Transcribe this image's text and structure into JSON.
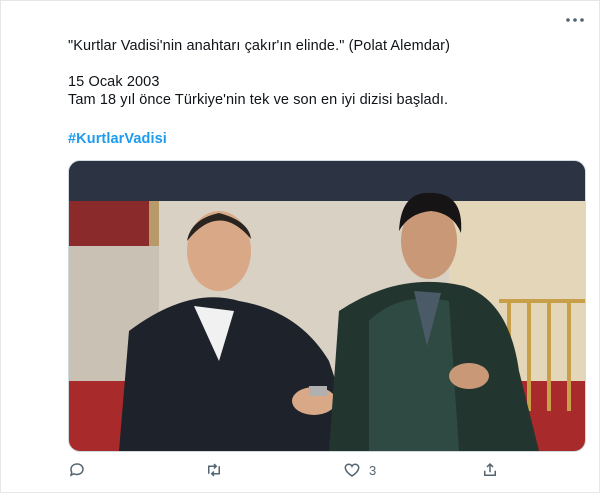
{
  "tweet": {
    "quote_line": "\"Kurtlar Vadisi'nin anahtarı çakır'ın elinde.\" (Polat Alemdar)",
    "date_line": "15 Ocak 2003",
    "body_line": "Tam 18 yıl önce Türkiye'nin tek ve son en iyi dizisi başladı.",
    "hashtag": "#KurtlarVadisi"
  },
  "media": {
    "description_icon": "photo"
  },
  "actions": {
    "reply_icon": "reply-icon",
    "retweet_icon": "retweet-icon",
    "like_icon": "heart-icon",
    "like_count": "3",
    "share_icon": "share-icon"
  },
  "colors": {
    "hashtag": "#1d9bf0",
    "icon": "#536471"
  }
}
